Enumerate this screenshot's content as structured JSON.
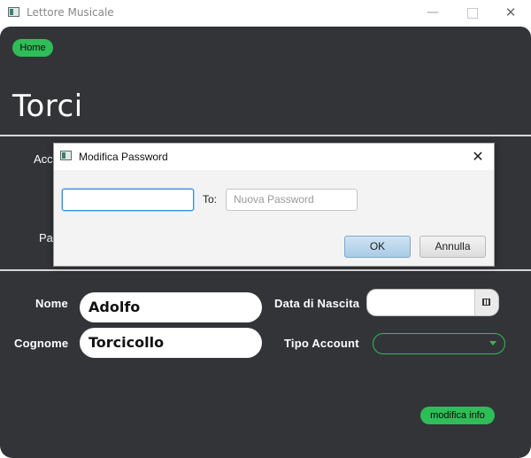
{
  "window": {
    "title": "Lettore Musicale",
    "minimize": "—",
    "close": "✕"
  },
  "app": {
    "home_label": "Home",
    "page_title": "Torci",
    "partial_labels": {
      "acc": "Acc",
      "pa": "Pa"
    },
    "form": {
      "nome_label": "Nome",
      "nome_value": "Adolfo",
      "cognome_label": "Cognome",
      "cognome_value": "Torcicollo",
      "data_nascita_label": "Data di Nascita",
      "data_nascita_value": "",
      "tipo_account_label": "Tipo Account",
      "tipo_account_value": ""
    },
    "modify_label": "modifica info"
  },
  "dialog": {
    "title": "Modifica Password",
    "current_password_value": "",
    "to_label": "To:",
    "new_password_placeholder": "Nuova Password",
    "ok_label": "OK",
    "cancel_label": "Annulla",
    "close": "✕"
  },
  "colors": {
    "accent_green": "#2ebd56",
    "background_dark": "#333438"
  }
}
